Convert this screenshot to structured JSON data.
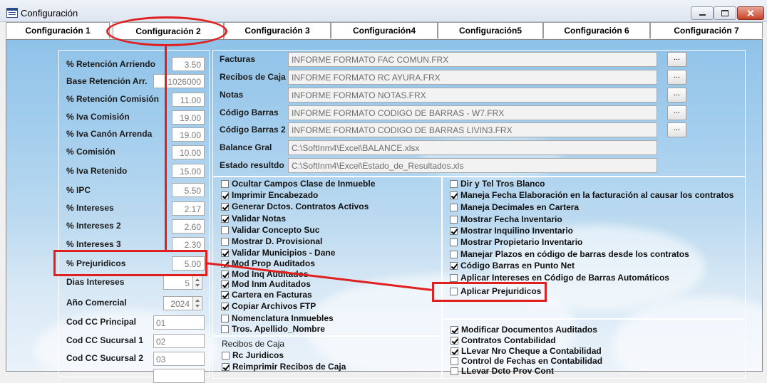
{
  "window": {
    "title": "Configuración"
  },
  "tabs": [
    {
      "label": "Configuración 1"
    },
    {
      "label": "Configuración 2"
    },
    {
      "label": "Configuración 3"
    },
    {
      "label": "Configuración4"
    },
    {
      "label": "Configuración5"
    },
    {
      "label": "Configuración 6"
    },
    {
      "label": "Configuración 7"
    }
  ],
  "left_fields": [
    {
      "label": "% Retención Arriendo",
      "value": "3.50"
    },
    {
      "label": "Base Retención Arr.",
      "value": "1026000"
    },
    {
      "label": "% Retención Comisión",
      "value": "11.00"
    },
    {
      "label": "% Iva Comisión",
      "value": "19.00"
    },
    {
      "label": "% Iva Canón Arrenda",
      "value": "19.00"
    },
    {
      "label": "% Comisión",
      "value": "10.00"
    },
    {
      "label": "% Iva Retenido",
      "value": "15.00"
    },
    {
      "label": "% IPC",
      "value": "5.50"
    },
    {
      "label": "% Intereses",
      "value": "2.17"
    },
    {
      "label": "% Intereses 2",
      "value": "2.60"
    },
    {
      "label": "% Intereses 3",
      "value": "2.30"
    },
    {
      "label": "% Prejuridicos",
      "value": "5.00"
    },
    {
      "label": "Dias Intereses",
      "value": "5"
    },
    {
      "label": "Año Comercial",
      "value": "2024"
    },
    {
      "label": "Cod CC Principal",
      "value": "01"
    },
    {
      "label": "Cod CC Sucursal 1",
      "value": "02"
    },
    {
      "label": "Cod CC Sucursal 2",
      "value": "03"
    }
  ],
  "reports": [
    {
      "label": "Facturas",
      "value": "INFORME FORMATO FAC COMUN.FRX",
      "browse": "..."
    },
    {
      "label": "Recibos de Caja",
      "value": "INFORME FORMATO RC AYURA.FRX",
      "browse": "..."
    },
    {
      "label": "Notas",
      "value": "INFORME FORMATO NOTAS.FRX",
      "browse": "..."
    },
    {
      "label": "Código Barras",
      "value": "INFORME FORMATO CODIGO DE BARRAS - W7.FRX",
      "browse": "..."
    },
    {
      "label": "Código Barras 2",
      "value": "INFORME FORMATO CODIGO DE BARRAS LIVIN3.FRX",
      "browse": "..."
    },
    {
      "label": "Balance Gral",
      "value": "C:\\SoftInm4\\Excel\\BALANCE.xlsx"
    },
    {
      "label": "Estado resultdo",
      "value": "C:\\SoftInm4\\Excel\\Estado_de_Resultados.xls"
    }
  ],
  "options_mid": [
    {
      "label": "Ocultar Campos Clase de Inmueble",
      "checked": false
    },
    {
      "label": "Imprimir Encabezado",
      "checked": true
    },
    {
      "label": "Generar Dctos. Contratos Activos",
      "checked": true
    },
    {
      "label": "Validar Notas",
      "checked": true
    },
    {
      "label": "Validar Concepto Suc",
      "checked": false
    },
    {
      "label": "Mostrar D. Provisional",
      "checked": false
    },
    {
      "label": "Validar Municipios - Dane",
      "checked": true
    },
    {
      "label": "Mod Prop Auditados",
      "checked": true
    },
    {
      "label": "Mod Inq Auditados",
      "checked": true
    },
    {
      "label": "Mod Inm Auditados",
      "checked": true
    },
    {
      "label": "Cartera en Facturas",
      "checked": true
    },
    {
      "label": "Copiar Archivos FTP",
      "checked": true
    },
    {
      "label": "Nomenclatura Inmuebles",
      "checked": false
    },
    {
      "label": "Tros. Apellido_Nombre",
      "checked": false
    }
  ],
  "options_right": [
    {
      "label": "Dir y Tel Tros Blanco",
      "checked": false
    },
    {
      "label": "Maneja Fecha Elaboración en la facturación al causar los contratos",
      "checked": true
    },
    {
      "label": "Maneja Decimales en Cartera",
      "checked": false
    },
    {
      "label": "Mostrar Fecha Inventario",
      "checked": false
    },
    {
      "label": "Mostrar Inquilino Inventario",
      "checked": true
    },
    {
      "label": "Mostrar Propietario Inventario",
      "checked": false
    },
    {
      "label": "Manejar Plazos en código de barras desde los contratos",
      "checked": false
    },
    {
      "label": "Código Barras en Punto Net",
      "checked": true
    },
    {
      "label": "Aplicar Intereses en Código de Barras Automáticos",
      "checked": false
    },
    {
      "label": "Aplicar Prejuridicos",
      "checked": false
    }
  ],
  "recibos": {
    "title": "Recibos de Caja",
    "items": [
      {
        "label": "Rc Juridicos",
        "checked": false
      },
      {
        "label": "Reimprimir Recibos de Caja",
        "checked": true
      }
    ]
  },
  "options_bottom": [
    {
      "label": "Modificar Documentos Auditados",
      "checked": true
    },
    {
      "label": "Contratos Contabilidad",
      "checked": true
    },
    {
      "label": "LLevar Nro Cheque a Contabilidad",
      "checked": true
    },
    {
      "label": "Control de Fechas en Contabilidad",
      "checked": false
    },
    {
      "label": "LLevar Dcto Prov Cont",
      "checked": false
    }
  ],
  "colors": {
    "highlight": "#e0201f",
    "sky": "#a6cfee"
  }
}
